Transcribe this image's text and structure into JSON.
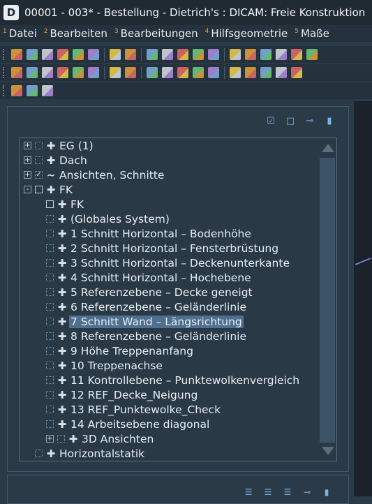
{
  "titlebar": {
    "logo_letter": "D",
    "title": "00001 - 003* - Bestellung - Dietrich's : DICAM: Freie Konstruktion"
  },
  "menu": [
    {
      "num": "1",
      "label": "Datei"
    },
    {
      "num": "2",
      "label": "Bearbeiten"
    },
    {
      "num": "3",
      "label": "Bearbeitungen"
    },
    {
      "num": "4",
      "label": "Hilfsgeometrie"
    },
    {
      "num": "5",
      "label": "Maße"
    }
  ],
  "toolbar1": [
    "new-icon",
    "open-icon",
    "save-icon",
    "save-as-icon",
    "save-all-icon",
    "exit-icon",
    "undo-icon",
    "redo-icon",
    "copy-icon",
    "panel-icon",
    "window-icon",
    "layout-icon",
    "view-icon",
    "list-icon",
    "home-icon",
    "roof-icon",
    "truss-icon",
    "export-icon",
    "settings-icon"
  ],
  "toolbar2": [
    "select-icon",
    "select-plus-icon",
    "select-area-icon",
    "pointer-icon",
    "plane-icon",
    "panel-a-icon",
    "panel-b-icon",
    "document-icon",
    "layers-icon",
    "text-a-icon",
    "text-b-icon",
    "text-c-icon",
    "text-d-icon",
    "book-icon",
    "cut-icon",
    "table-icon",
    "orange-box-icon",
    "wave-icon"
  ],
  "toolbar3": [
    "points-icon",
    "point-grid-icon",
    "point-delete-icon"
  ],
  "panel": {
    "toolbar_icons": [
      "check-all-icon",
      "uncheck-all-icon",
      "pin-icon",
      "dock-icon"
    ]
  },
  "tree": [
    {
      "level": 0,
      "expander": "+",
      "checkbox": "dotted",
      "check": "",
      "icon": "✚",
      "label": "EG (1)"
    },
    {
      "level": 0,
      "expander": "+",
      "checkbox": "dotted",
      "check": "",
      "icon": "✚",
      "label": "Dach"
    },
    {
      "level": 0,
      "expander": "+",
      "checkbox": "dotted",
      "check": "✓",
      "icon": "~",
      "label": "Ansichten, Schnitte"
    },
    {
      "level": 0,
      "expander": "-",
      "checkbox": "solid",
      "check": "",
      "icon": "✚",
      "label": "FK"
    },
    {
      "level": 1,
      "expander": "",
      "checkbox": "solid",
      "check": "",
      "icon": "✚",
      "label": "FK"
    },
    {
      "level": 1,
      "expander": "",
      "checkbox": "dotted",
      "check": "",
      "icon": "✚",
      "label": "(Globales System)"
    },
    {
      "level": 1,
      "expander": "",
      "checkbox": "dotted",
      "check": "",
      "icon": "✚",
      "label": "1 Schnitt Horizontal – Bodenhöhe"
    },
    {
      "level": 1,
      "expander": "",
      "checkbox": "dotted",
      "check": "",
      "icon": "✚",
      "label": "2 Schnitt Horizontal – Fensterbrüstung"
    },
    {
      "level": 1,
      "expander": "",
      "checkbox": "dotted",
      "check": "",
      "icon": "✚",
      "label": "3 Schnitt Horizontal – Deckenunterkante"
    },
    {
      "level": 1,
      "expander": "",
      "checkbox": "dotted",
      "check": "",
      "icon": "✚",
      "label": "4 Schnitt Horizontal – Hochebene"
    },
    {
      "level": 1,
      "expander": "",
      "checkbox": "dotted",
      "check": "",
      "icon": "✚",
      "label": "5 Referenzebene – Decke geneigt"
    },
    {
      "level": 1,
      "expander": "",
      "checkbox": "dotted",
      "check": "",
      "icon": "✚",
      "label": "6 Referenzebene – Geländerlinie"
    },
    {
      "level": 1,
      "expander": "",
      "checkbox": "dotted",
      "check": "",
      "icon": "✚",
      "label": "7 Schnitt Wand – Längsrichtung",
      "selected": true
    },
    {
      "level": 1,
      "expander": "",
      "checkbox": "dotted",
      "check": "",
      "icon": "✚",
      "label": "8 Referenzebene – Geländerlinie"
    },
    {
      "level": 1,
      "expander": "",
      "checkbox": "dotted",
      "check": "",
      "icon": "✚",
      "label": "9 Höhe Treppenanfang"
    },
    {
      "level": 1,
      "expander": "",
      "checkbox": "dotted",
      "check": "",
      "icon": "✚",
      "label": "10 Treppenachse"
    },
    {
      "level": 1,
      "expander": "",
      "checkbox": "dotted",
      "check": "",
      "icon": "✚",
      "label": "11 Kontrollebene – Punktewolkenvergleich"
    },
    {
      "level": 1,
      "expander": "",
      "checkbox": "dotted",
      "check": "",
      "icon": "✚",
      "label": "12 REF_Decke_Neigung"
    },
    {
      "level": 1,
      "expander": "",
      "checkbox": "dotted",
      "check": "",
      "icon": "✚",
      "label": "13 REF_Punktewolke_Check"
    },
    {
      "level": 1,
      "expander": "",
      "checkbox": "dotted",
      "check": "",
      "icon": "✚",
      "label": "14 Arbeitsebene diagonal"
    },
    {
      "level": 1,
      "expander": "+",
      "checkbox": "dotted",
      "check": "",
      "icon": "✚",
      "label": "3D Ansichten"
    },
    {
      "level": 0,
      "expander": "",
      "checkbox": "dotted",
      "check": "",
      "icon": "✚",
      "label": "Horizontalstatik"
    }
  ],
  "bottom_panel": {
    "toolbar_icons": [
      "align-left-icon",
      "align-center-icon",
      "align-right-icon",
      "pin-icon",
      "dock-icon"
    ]
  },
  "colors": {
    "background": "#2b3a47",
    "selection": "#4f6f8f",
    "accent_number": "#f29a2e",
    "icon_blue": "#7fb1e8"
  }
}
